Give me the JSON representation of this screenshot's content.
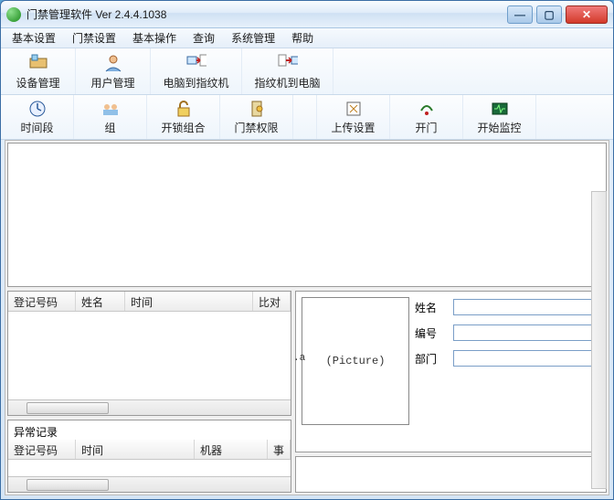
{
  "window": {
    "title": "门禁管理软件  Ver 2.4.4.1038"
  },
  "menu": [
    "基本设置",
    "门禁设置",
    "基本操作",
    "查询",
    "系统管理",
    "帮助"
  ],
  "toolbar1": [
    {
      "label": "设备管理",
      "icon": "device"
    },
    {
      "label": "用户管理",
      "icon": "user"
    },
    {
      "label": "电脑到指纹机",
      "icon": "pc2fp"
    },
    {
      "label": "指纹机到电脑",
      "icon": "fp2pc"
    }
  ],
  "toolbar2": [
    {
      "label": "时间段",
      "icon": "clock"
    },
    {
      "label": "组",
      "icon": "group"
    },
    {
      "label": "开锁组合",
      "icon": "unlock"
    },
    {
      "label": "门禁权限",
      "icon": "acl"
    },
    {
      "label": "上传设置",
      "icon": "upload",
      "spacer_before": true
    },
    {
      "label": "开门",
      "icon": "open"
    },
    {
      "label": "开始监控",
      "icon": "monitor"
    }
  ],
  "grid1": {
    "headers": [
      "登记号码",
      "姓名",
      "时间",
      "比对方式"
    ]
  },
  "grid2": {
    "title": "异常记录",
    "headers": [
      "登记号码",
      "时间",
      "机器",
      "事件"
    ]
  },
  "detail": {
    "picture_label": "(Picture)",
    "a_hint": ".a",
    "fields": [
      {
        "label": "姓名",
        "value": ""
      },
      {
        "label": "编号",
        "value": ""
      },
      {
        "label": "部门",
        "value": ""
      }
    ]
  }
}
